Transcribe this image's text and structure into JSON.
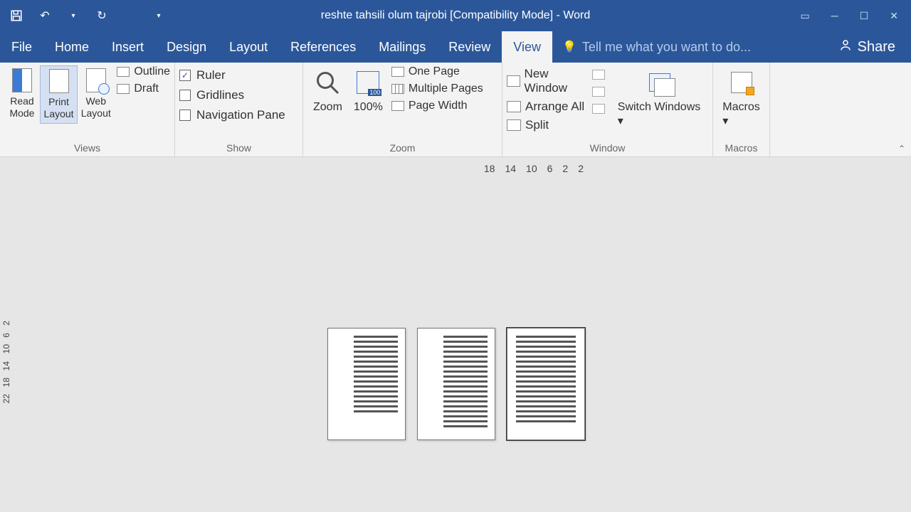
{
  "title": "reshte tahsili olum tajrobi [Compatibility Mode] - Word",
  "tabs": [
    "File",
    "Home",
    "Insert",
    "Design",
    "Layout",
    "References",
    "Mailings",
    "Review",
    "View"
  ],
  "active_tab": "View",
  "tellme": "Tell me what you want to do...",
  "share": "Share",
  "ribbon": {
    "views": {
      "read_mode": "Read Mode",
      "print_layout": "Print Layout",
      "web_layout": "Web Layout",
      "outline": "Outline",
      "draft": "Draft",
      "group": "Views"
    },
    "show": {
      "ruler": "Ruler",
      "gridlines": "Gridlines",
      "nav_pane": "Navigation Pane",
      "ruler_checked": true,
      "group": "Show"
    },
    "zoom": {
      "zoom": "Zoom",
      "hundred": "100%",
      "one_page": "One Page",
      "multi_pages": "Multiple Pages",
      "page_width": "Page Width",
      "group": "Zoom"
    },
    "window": {
      "new_window": "New Window",
      "arrange_all": "Arrange All",
      "split": "Split",
      "switch_windows": "Switch Windows",
      "group": "Window"
    },
    "macros": {
      "macros": "Macros",
      "group": "Macros"
    }
  },
  "ruler_marks": [
    "18",
    "14",
    "10",
    "6",
    "2",
    "2"
  ],
  "vruler_marks": [
    "2",
    "6",
    "10",
    "14",
    "18",
    "22"
  ]
}
